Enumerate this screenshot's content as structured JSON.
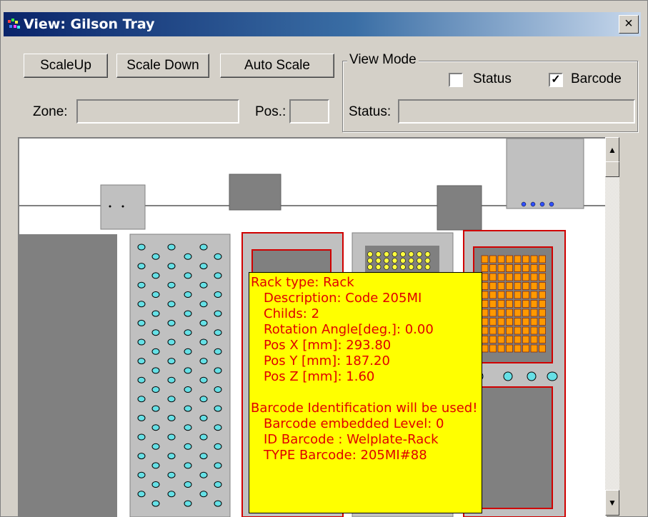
{
  "window": {
    "title": "View: Gilson Tray",
    "close_label": "×"
  },
  "toolbar": {
    "scale_up": "ScaleUp",
    "scale_down": "Scale Down",
    "auto_scale": "Auto Scale"
  },
  "fields": {
    "zone_label": "Zone:",
    "zone_value": "",
    "pos_label": "Pos.:",
    "pos_value": "",
    "status_label": "Status:",
    "status_value": ""
  },
  "view_mode": {
    "title": "View Mode",
    "status_label": "Status",
    "status_checked": false,
    "barcode_label": "Barcode",
    "barcode_checked": true
  },
  "tooltip": {
    "rack_type": "Rack type: Rack",
    "description": "Description:  Code 205MI",
    "childs": "Childs:  2",
    "rotation": "Rotation Angle[deg.]:  0.00",
    "pos_x": "Pos X [mm]: 293.80",
    "pos_y": "Pos Y [mm]: 187.20",
    "pos_z": "Pos Z [mm]: 1.60",
    "barcode_used": "Barcode Identification will be used!",
    "embedded_level": "Barcode embedded Level: 0",
    "id_barcode": "ID Barcode : Welplate-Rack",
    "type_barcode": "TYPE Barcode: 205MI#88"
  },
  "colors": {
    "titlebar_start": "#0a246a",
    "rack_fill": "#c0c0c0",
    "rack_dark": "#808080",
    "selected_outline": "#d00000",
    "tube_fill": "#66e0e6",
    "well_fill": "#ff9900",
    "tooltip_bg": "#ffff00",
    "tooltip_text": "#e00000"
  }
}
